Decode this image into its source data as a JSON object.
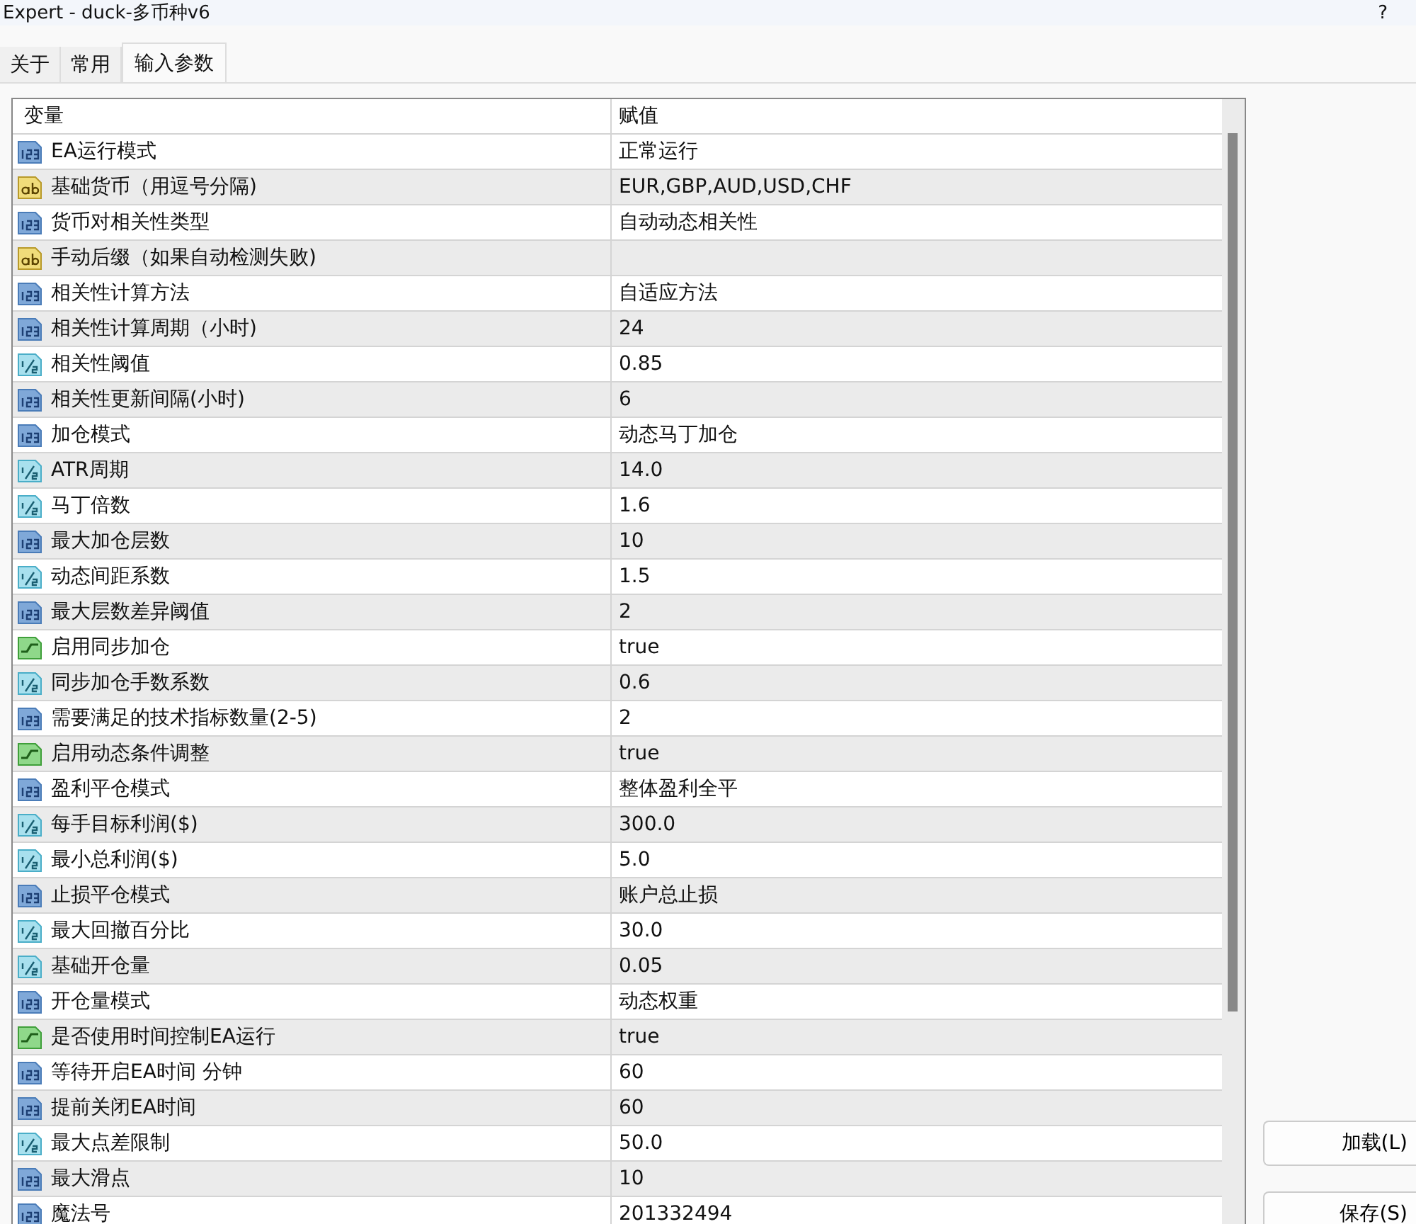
{
  "window": {
    "title": "Expert - duck-多币种v6",
    "help": "?"
  },
  "tabs": [
    {
      "label": "关于",
      "selected": false
    },
    {
      "label": "常用",
      "selected": false
    },
    {
      "label": "输入参数",
      "selected": true
    }
  ],
  "table": {
    "columns": [
      "变量",
      "赋值"
    ],
    "rows": [
      {
        "kind": "int",
        "name": "EA运行模式",
        "value": "正常运行"
      },
      {
        "kind": "string",
        "name": "基础货币（用逗号分隔)",
        "value": "EUR,GBP,AUD,USD,CHF"
      },
      {
        "kind": "int",
        "name": "货币对相关性类型",
        "value": "自动动态相关性"
      },
      {
        "kind": "string",
        "name": "手动后缀（如果自动检测失败)",
        "value": ""
      },
      {
        "kind": "int",
        "name": "相关性计算方法",
        "value": "自适应方法"
      },
      {
        "kind": "int",
        "name": "相关性计算周期（小时)",
        "value": "24"
      },
      {
        "kind": "double",
        "name": "相关性阈值",
        "value": "0.85"
      },
      {
        "kind": "int",
        "name": "相关性更新间隔(小时)",
        "value": "6"
      },
      {
        "kind": "int",
        "name": "加仓模式",
        "value": "动态马丁加仓"
      },
      {
        "kind": "double",
        "name": "ATR周期",
        "value": "14.0"
      },
      {
        "kind": "double",
        "name": "马丁倍数",
        "value": "1.6"
      },
      {
        "kind": "int",
        "name": "最大加仓层数",
        "value": "10"
      },
      {
        "kind": "double",
        "name": "动态间距系数",
        "value": "1.5"
      },
      {
        "kind": "int",
        "name": "最大层数差异阈值",
        "value": "2"
      },
      {
        "kind": "bool",
        "name": "启用同步加仓",
        "value": "true"
      },
      {
        "kind": "double",
        "name": "同步加仓手数系数",
        "value": "0.6"
      },
      {
        "kind": "int",
        "name": "需要满足的技术指标数量(2-5)",
        "value": "2"
      },
      {
        "kind": "bool",
        "name": "启用动态条件调整",
        "value": "true"
      },
      {
        "kind": "int",
        "name": "盈利平仓模式",
        "value": "整体盈利全平"
      },
      {
        "kind": "double",
        "name": "每手目标利润($)",
        "value": "300.0"
      },
      {
        "kind": "double",
        "name": "最小总利润($)",
        "value": "5.0"
      },
      {
        "kind": "int",
        "name": "止损平仓模式",
        "value": "账户总止损"
      },
      {
        "kind": "double",
        "name": "最大回撤百分比",
        "value": "30.0"
      },
      {
        "kind": "double",
        "name": "基础开仓量",
        "value": "0.05"
      },
      {
        "kind": "int",
        "name": "开仓量模式",
        "value": "动态权重"
      },
      {
        "kind": "bool",
        "name": "是否使用时间控制EA运行",
        "value": "true"
      },
      {
        "kind": "int",
        "name": "等待开启EA时间 分钟",
        "value": "60"
      },
      {
        "kind": "int",
        "name": "提前关闭EA时间",
        "value": "60"
      },
      {
        "kind": "double",
        "name": "最大点差限制",
        "value": "50.0"
      },
      {
        "kind": "int",
        "name": "最大滑点",
        "value": "10"
      },
      {
        "kind": "int",
        "name": "魔法号",
        "value": "201332494"
      }
    ]
  },
  "buttons": [
    {
      "label": "加载(L)"
    },
    {
      "label": "保存(S)"
    }
  ]
}
